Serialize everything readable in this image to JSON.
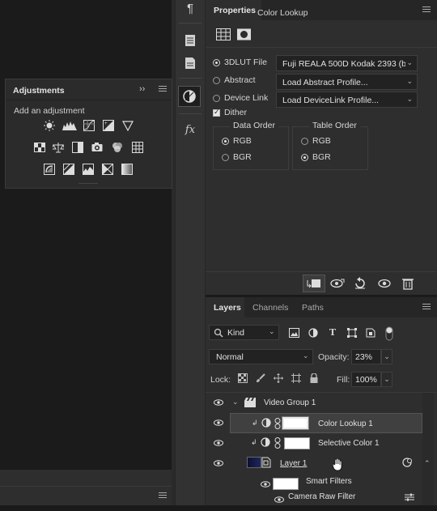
{
  "adjustments": {
    "title": "Adjustments",
    "expand_label": "››",
    "subtitle": "Add an adjustment"
  },
  "properties": {
    "tab": "Properties",
    "type_label": "Color Lookup",
    "lut_options": [
      {
        "label": "3DLUT File",
        "selected": true,
        "value": "Fuji REALA 500D Kodak 2393 (b..."
      },
      {
        "label": "Abstract",
        "selected": false,
        "value": "Load Abstract Profile..."
      },
      {
        "label": "Device Link",
        "selected": false,
        "value": "Load DeviceLink Profile..."
      }
    ],
    "dither_label": "Dither",
    "dither_checked": true,
    "data_order": {
      "title": "Data Order",
      "options": [
        "RGB",
        "BGR"
      ],
      "selected": "RGB"
    },
    "table_order": {
      "title": "Table Order",
      "options": [
        "RGB",
        "BGR"
      ],
      "selected": "BGR"
    }
  },
  "layers_panel": {
    "tabs": [
      "Layers",
      "Channels",
      "Paths"
    ],
    "active_tab": "Layers",
    "filter_kind": "Kind",
    "blend_mode": "Normal",
    "opacity_label": "Opacity:",
    "opacity_value": "23%",
    "lock_label": "Lock:",
    "fill_label": "Fill:",
    "fill_value": "100%",
    "layers": [
      {
        "name": "Video Group 1",
        "type": "group"
      },
      {
        "name": "Color Lookup 1",
        "type": "adjustment",
        "selected": true
      },
      {
        "name": "Selective Color 1",
        "type": "adjustment"
      },
      {
        "name": "Layer 1",
        "type": "smart-object"
      },
      {
        "name": "Smart Filters",
        "type": "filter-group"
      },
      {
        "name": "Camera Raw Filter",
        "type": "filter"
      }
    ]
  },
  "colors": {
    "panel_bg": "#2e2e2e",
    "dark_bg": "#1b1b1b",
    "selected_row": "#404040",
    "text": "#e0e0e0"
  }
}
